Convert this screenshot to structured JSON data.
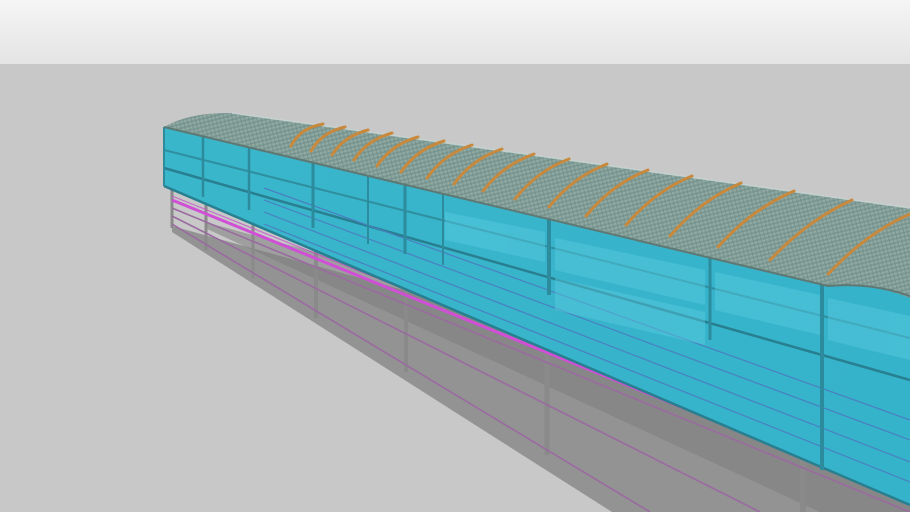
{
  "scene": {
    "subject": "covered-walkway-3d-model",
    "colors": {
      "sky_top": "#f4f4f4",
      "sky_bottom": "#e6e6e6",
      "ground": "#c9c9c9",
      "glass": "#38b8cc",
      "glass_dark": "#2a9fb4",
      "glass_light": "#5ccbe0",
      "frame": "#2f7f8d",
      "roof": "#8fa8a2",
      "roof_stripe": "#7a9590",
      "roof_rib": "#c98a3e",
      "rail": "#d24fd6",
      "post": "#8a8a8a",
      "shadow": "#8c8c8c"
    }
  }
}
